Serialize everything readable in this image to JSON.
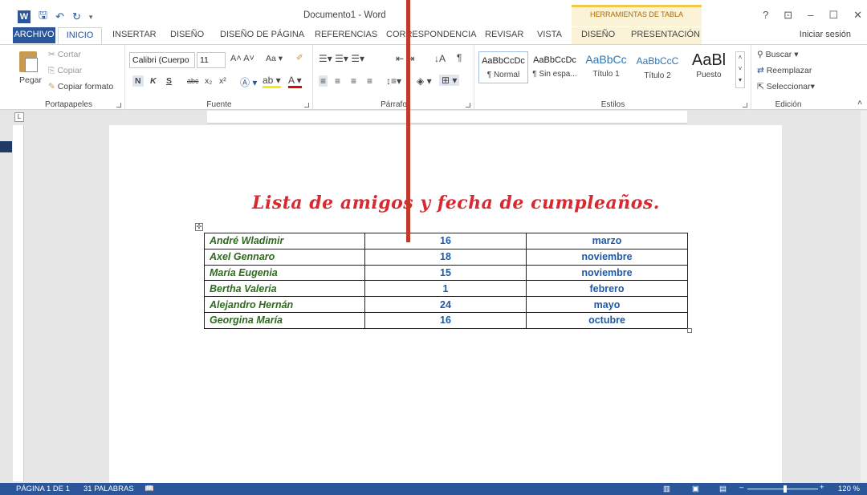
{
  "window": {
    "title": "Documento1 - Word",
    "table_tools": "HERRAMIENTAS DE TABLA",
    "help": "?",
    "controls": [
      "⊡",
      "–",
      "☐",
      "✕"
    ]
  },
  "tabs": {
    "file": "ARCHIVO",
    "items": [
      "INICIO",
      "INSERTAR",
      "DISEÑO",
      "DISEÑO DE PÁGINA",
      "REFERENCIAS",
      "CORRESPONDENCIA",
      "REVISAR",
      "VISTA",
      "DISEÑO",
      "PRESENTACIÓN"
    ],
    "sign_in": "Iniciar sesión"
  },
  "ribbon": {
    "clipboard": {
      "paste": "Pegar",
      "cut": "Cortar",
      "copy": "Copiar",
      "format_painter": "Copiar formato",
      "label": "Portapapeles"
    },
    "font": {
      "font_name": "Calibri (Cuerpo",
      "font_size": "11",
      "bold": "N",
      "italic": "K",
      "underline": "S",
      "strike": "abc",
      "sub": "x₂",
      "sup": "x²",
      "label": "Fuente"
    },
    "paragraph": {
      "label": "Párrafo"
    },
    "styles": {
      "items": [
        {
          "sample": "AaBbCcDc",
          "name": "¶ Normal"
        },
        {
          "sample": "AaBbCcDc",
          "name": "¶ Sin espa..."
        },
        {
          "sample": "AaBbCc",
          "name": "Título 1"
        },
        {
          "sample": "AaBbCcC",
          "name": "Título 2"
        },
        {
          "sample": "AaBl",
          "name": "Puesto"
        }
      ],
      "label": "Estilos"
    },
    "editing": {
      "find": "Buscar",
      "replace": "Reemplazar",
      "select": "Seleccionar",
      "label": "Edición"
    }
  },
  "document": {
    "heading": "Lista de amigos y fecha de cumpleaños.",
    "table": [
      [
        "André Wladimir",
        "16",
        "marzo"
      ],
      [
        "Axel Gennaro",
        "18",
        "noviembre"
      ],
      [
        "María Eugenia",
        "15",
        "noviembre"
      ],
      [
        "Bertha Valeria",
        "1",
        "febrero"
      ],
      [
        "Alejandro Hernán",
        "24",
        "mayo"
      ],
      [
        "Georgina María",
        "16",
        "octubre"
      ]
    ]
  },
  "status": {
    "page": "PÁGINA 1 DE 1",
    "words": "31 PALABRAS",
    "zoom": "120 %"
  },
  "colors": {
    "accent": "#2b579a",
    "heading": "#d9282f",
    "names": "#2e6b1f",
    "values": "#1e5aa8",
    "annotation_line": "#c0392b"
  }
}
